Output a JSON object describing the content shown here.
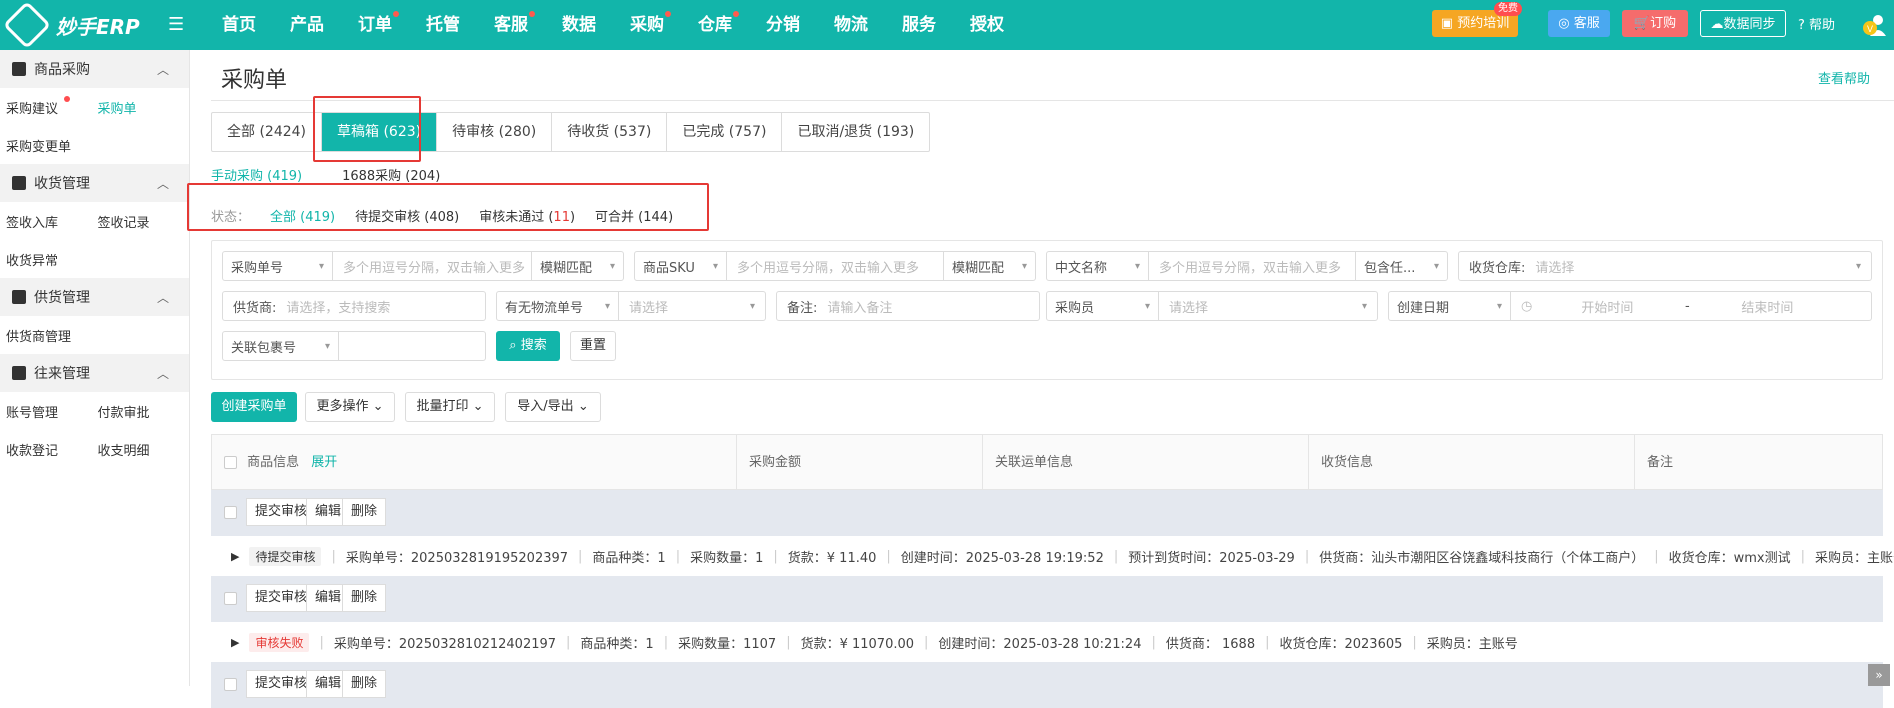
{
  "brand": {
    "name": "妙手ERP"
  },
  "nav": [
    {
      "label": "首页",
      "dot": false
    },
    {
      "label": "产品",
      "dot": false
    },
    {
      "label": "订单",
      "dot": true
    },
    {
      "label": "托管",
      "dot": false
    },
    {
      "label": "客服",
      "dot": true
    },
    {
      "label": "数据",
      "dot": false
    },
    {
      "label": "采购",
      "dot": true
    },
    {
      "label": "仓库",
      "dot": true
    },
    {
      "label": "分销",
      "dot": false
    },
    {
      "label": "物流",
      "dot": false
    },
    {
      "label": "服务",
      "dot": false
    },
    {
      "label": "授权",
      "dot": false
    }
  ],
  "topright": {
    "training": "预约培训",
    "free_badge": "免费",
    "service": "客服",
    "order": "订购",
    "sync": "数据同步",
    "help": "帮助"
  },
  "sidebar": {
    "groups": [
      {
        "title": "商品采购",
        "rows": [
          [
            "采购建议",
            "采购单"
          ],
          [
            "采购变更单"
          ]
        ]
      },
      {
        "title": "收货管理",
        "rows": [
          [
            "签收入库",
            "签收记录"
          ],
          [
            "收货异常"
          ]
        ]
      },
      {
        "title": "供货管理",
        "rows": [
          [
            "供货商管理"
          ]
        ]
      },
      {
        "title": "往来管理",
        "rows": [
          [
            "账号管理",
            "付款审批"
          ],
          [
            "收款登记",
            "收支明细"
          ]
        ]
      }
    ]
  },
  "page": {
    "title": "采购单",
    "help_link": "查看帮助"
  },
  "tabs": [
    "全部 (2424)",
    "草稿箱 (623)",
    "待审核 (280)",
    "待收货 (537)",
    "已完成 (757)",
    "已取消/退货 (193)"
  ],
  "subtabs": [
    "手动采购 (419)",
    "1688采购 (204)"
  ],
  "status": {
    "label": "状态：",
    "items": [
      "全部 (419)",
      "待提交审核 (408)",
      "审核未通过",
      "可合并 (144)"
    ],
    "fail_prefix": "审核未通过 (",
    "fail_count": "11",
    "fail_suffix": ")"
  },
  "filters": {
    "f1_sel": "采购单号",
    "f1_ph": "多个用逗号分隔，双击输入更多",
    "f1_mode": "模糊匹配",
    "f2_sel": "商品SKU",
    "f2_ph": "多个用逗号分隔，双击输入更多",
    "f2_mode": "模糊匹配",
    "f3_sel": "中文名称",
    "f3_ph": "多个用逗号分隔，双击输入更多",
    "f3_mode": "包含任...",
    "f4_pre": "收货仓库:",
    "f4_ph": "请选择",
    "f5_pre": "供货商:",
    "f5_ph": "请选择，支持搜索",
    "f6_sel": "有无物流单号",
    "f6_ph": "请选择",
    "f7_pre": "备注:",
    "f7_ph": "请输入备注",
    "f8_sel": "采购员",
    "f8_ph": "请选择",
    "f9_sel": "创建日期",
    "f9_start": "开始时间",
    "f9_dash": "-",
    "f9_end": "结束时间",
    "f10_sel": "关联包裹号",
    "search": "搜索",
    "reset": "重置"
  },
  "actions": {
    "create": "创建采购单",
    "more": "更多操作",
    "print": "批量打印",
    "io": "导入/导出"
  },
  "table": {
    "cols": [
      "商品信息",
      "采购金额",
      "关联运单信息",
      "收货信息",
      "备注"
    ],
    "expand": "展开"
  },
  "row_buttons": [
    "提交审核",
    "编辑",
    "删除"
  ],
  "orders": [
    {
      "status": "待提交审核",
      "fields": [
        "采购单号：2025032819195202397",
        "商品种类：1",
        "采购数量：1",
        "货款：¥ 11.40",
        "创建时间：2025-03-28 19:19:52",
        "预计到货时间：2025-03-29",
        "供货商：汕头市潮阳区谷饶鑫域科技商行（个体工商户）",
        "收货仓库：wmx测试",
        "采购员：主账号"
      ]
    },
    {
      "status": "审核失败",
      "fields": [
        "采购单号：2025032810212402197",
        "商品种类：1",
        "采购数量：1107",
        "货款：¥ 11070.00",
        "创建时间：2025-03-28 10:21:24",
        "供货商： 1688",
        "收货仓库：2023605",
        "采购员：主账号"
      ]
    }
  ]
}
